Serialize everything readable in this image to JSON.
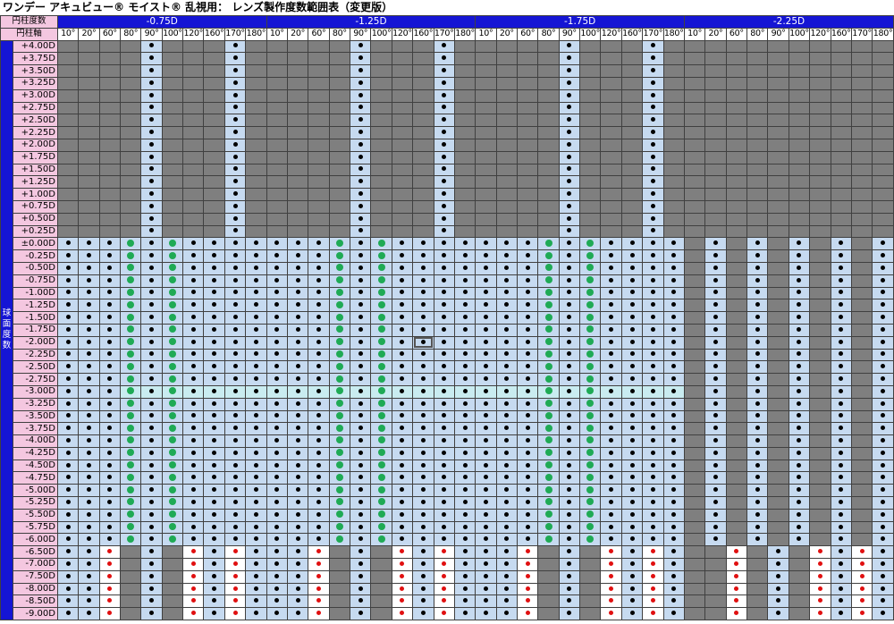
{
  "title": "ワンデー アキュビュー® モイスト® 乱視用： レンズ製作度数範囲表（変更版）",
  "header": {
    "cyl_label": "円柱度数",
    "axis_label": "円柱軸",
    "side_label": "球面度数"
  },
  "cylinders": [
    "-0.75D",
    "-1.25D",
    "-1.75D",
    "-2.25D"
  ],
  "axes": [
    "10°",
    "20°",
    "60°",
    "80°",
    "90°",
    "100°",
    "120°",
    "160°",
    "170°",
    "180°"
  ],
  "spheres": [
    "+4.00D",
    "+3.75D",
    "+3.50D",
    "+3.25D",
    "+3.00D",
    "+2.75D",
    "+2.50D",
    "+2.25D",
    "+2.00D",
    "+1.75D",
    "+1.50D",
    "+1.25D",
    "+1.00D",
    "+0.75D",
    "+0.50D",
    "+0.25D",
    "±0.00D",
    "-0.25D",
    "-0.50D",
    "-0.75D",
    "-1.00D",
    "-1.25D",
    "-1.50D",
    "-1.75D",
    "-2.00D",
    "-2.25D",
    "-2.50D",
    "-2.75D",
    "-3.00D",
    "-3.25D",
    "-3.50D",
    "-3.75D",
    "-4.00D",
    "-4.25D",
    "-4.50D",
    "-4.75D",
    "-5.00D",
    "-5.25D",
    "-5.50D",
    "-5.75D",
    "-6.00D",
    "-6.50D",
    "-7.00D",
    "-7.50D",
    "-8.00D",
    "-8.50D",
    "-9.00D"
  ],
  "availability_codes": {
    "plus": [
      "....x...x.",
      "....x...x.",
      "....x...x.",
      "----------"
    ],
    "mid": [
      "...G.G....",
      "...G.G....",
      "...G.G....",
      ".x.x.x.x.x"
    ],
    "high": [
      "..R.x.R.R.",
      "..R.x.R.R.",
      "..R.x.R.R.",
      "..R.x.R.R."
    ]
  },
  "legend": {
    "black_dot": "●",
    "green_dot": "●",
    "red_dot": "●"
  },
  "colors": {
    "header_blue": "#1515d4",
    "label_pink": "#f4c7e0",
    "unavailable_gray": "#7f7f7f",
    "available_blue": "#c6daf0",
    "highlight_teal": "#c9ecf0",
    "green_dot": "#1faa55",
    "red_dot": "#e01010"
  }
}
